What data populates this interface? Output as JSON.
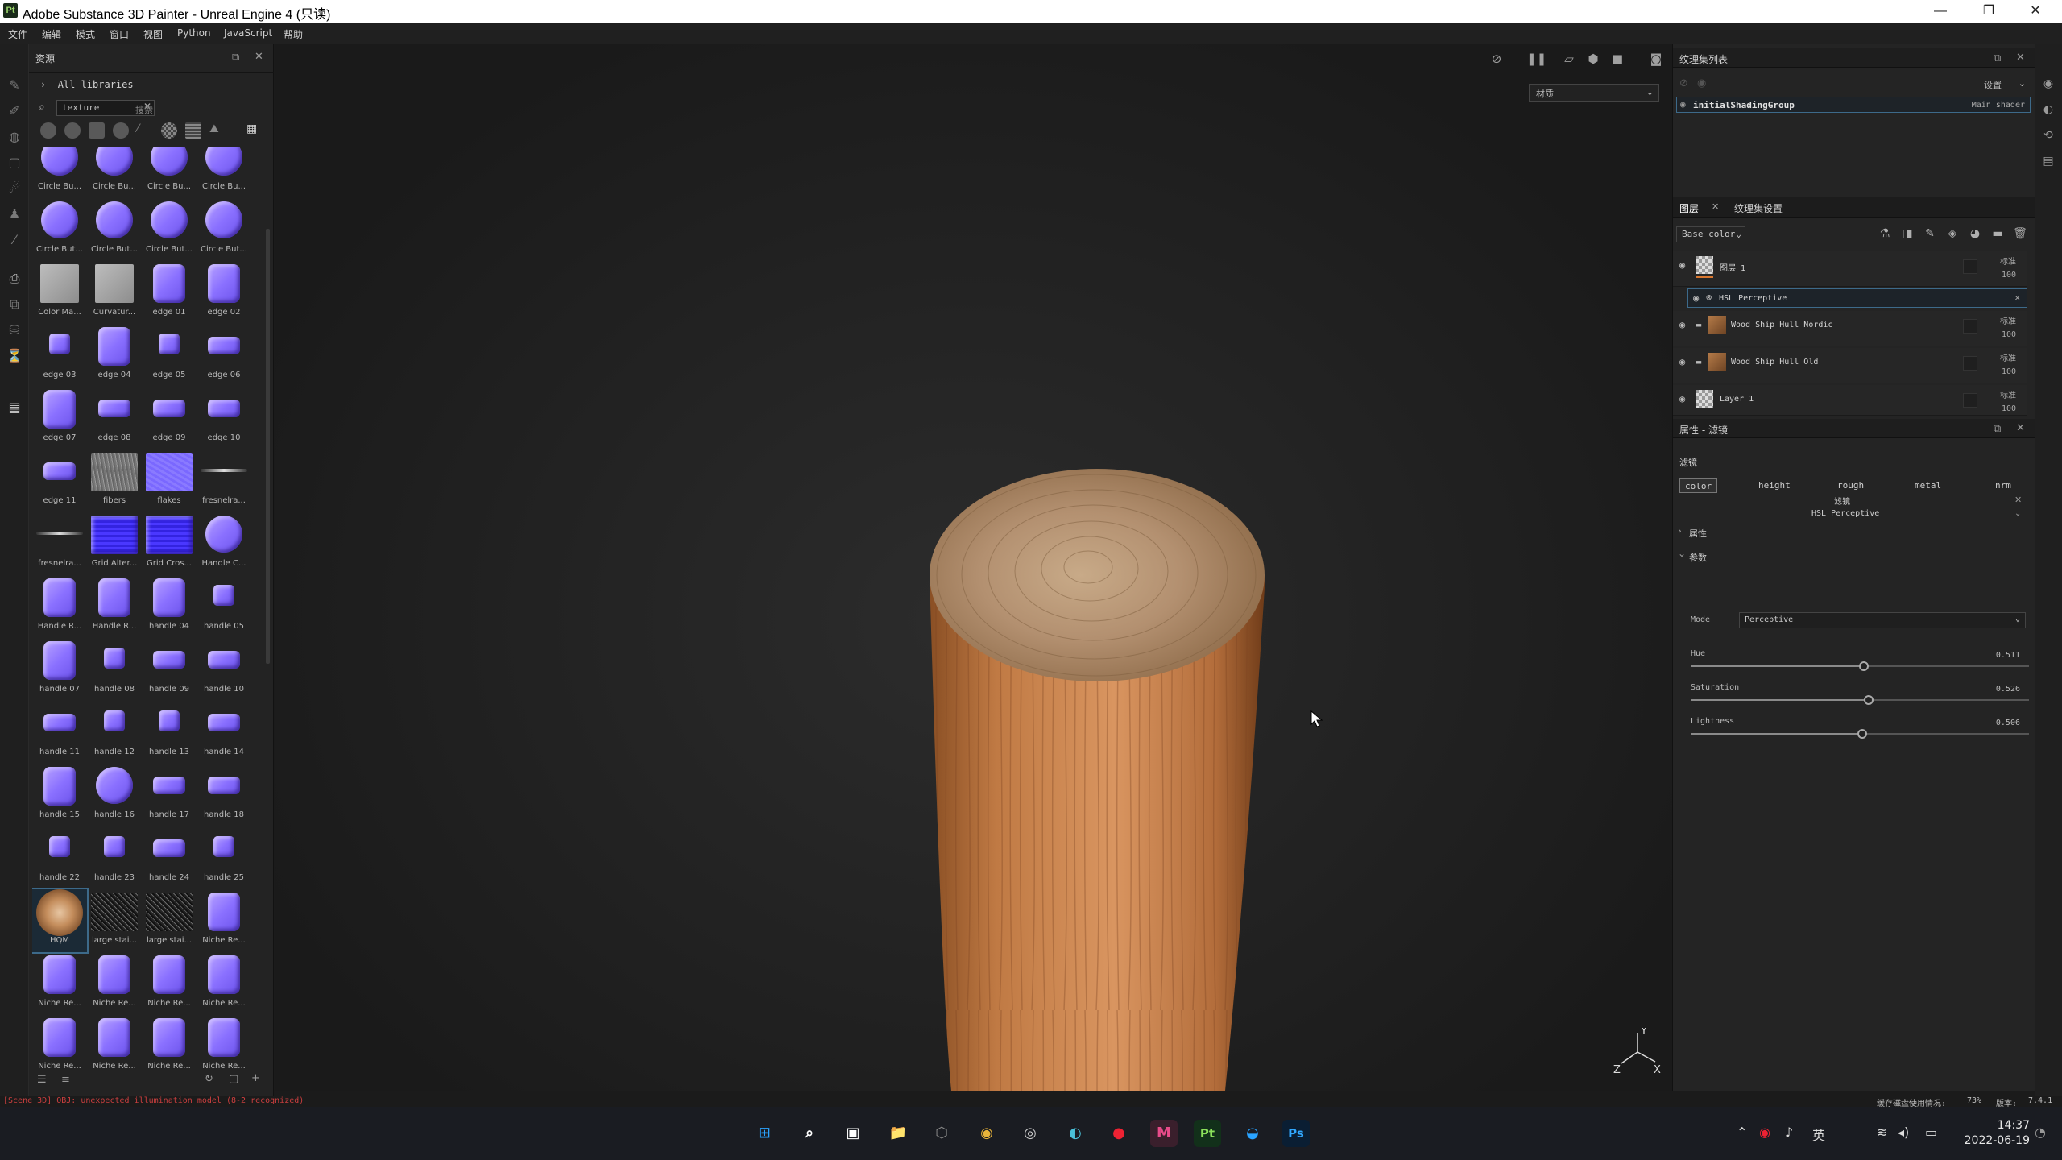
{
  "window": {
    "title": "Adobe Substance 3D Painter - Unreal Engine 4 (只读)",
    "app_icon": "Pt",
    "controls": [
      "—",
      "❐",
      "✕"
    ]
  },
  "menu": [
    "文件",
    "编辑",
    "模式",
    "窗口",
    "视图",
    "Python",
    "JavaScript",
    "帮助"
  ],
  "assets_panel": {
    "title": "资源",
    "breadcrumb": "All libraries",
    "search_value": "texture",
    "search_label": "搜索",
    "items": [
      {
        "label": "Circle Bu...",
        "shape": "round"
      },
      {
        "label": "Circle Bu...",
        "shape": "round"
      },
      {
        "label": "Circle Bu...",
        "shape": "round"
      },
      {
        "label": "Circle Bu...",
        "shape": "round"
      },
      {
        "label": "Circle But...",
        "shape": "round"
      },
      {
        "label": "Circle But...",
        "shape": "round"
      },
      {
        "label": "Circle But...",
        "shape": "round"
      },
      {
        "label": "Circle But...",
        "shape": "round"
      },
      {
        "label": "Color Ma...",
        "shape": "gray"
      },
      {
        "label": "Curvatur...",
        "shape": "gray"
      },
      {
        "label": "edge 01",
        "shape": "tall"
      },
      {
        "label": "edge 02",
        "shape": "tall"
      },
      {
        "label": "edge 03",
        "shape": "small"
      },
      {
        "label": "edge 04",
        "shape": "tall"
      },
      {
        "label": "edge 05",
        "shape": "small"
      },
      {
        "label": "edge 06",
        "shape": "wide"
      },
      {
        "label": "edge 07",
        "shape": "tall"
      },
      {
        "label": "edge 08",
        "shape": "wide"
      },
      {
        "label": "edge 09",
        "shape": "wide"
      },
      {
        "label": "edge 10",
        "shape": "wide"
      },
      {
        "label": "edge 11",
        "shape": "wide"
      },
      {
        "label": "fibers",
        "shape": "fibers"
      },
      {
        "label": "flakes",
        "shape": "flakes"
      },
      {
        "label": "fresnelra...",
        "shape": "line"
      },
      {
        "label": "fresnelra...",
        "shape": "line"
      },
      {
        "label": "Grid Alter...",
        "shape": "gridpat"
      },
      {
        "label": "Grid Cros...",
        "shape": "gridpat"
      },
      {
        "label": "Handle C...",
        "shape": "round"
      },
      {
        "label": "Handle R...",
        "shape": "tall"
      },
      {
        "label": "Handle R...",
        "shape": "tall"
      },
      {
        "label": "handle 04",
        "shape": "tall"
      },
      {
        "label": "handle 05",
        "shape": "small"
      },
      {
        "label": "handle 07",
        "shape": "tall"
      },
      {
        "label": "handle 08",
        "shape": "small"
      },
      {
        "label": "handle 09",
        "shape": "wide"
      },
      {
        "label": "handle 10",
        "shape": "wide"
      },
      {
        "label": "handle 11",
        "shape": "wide"
      },
      {
        "label": "handle 12",
        "shape": "small"
      },
      {
        "label": "handle 13",
        "shape": "small"
      },
      {
        "label": "handle 14",
        "shape": "wide"
      },
      {
        "label": "handle 15",
        "shape": "tall"
      },
      {
        "label": "handle 16",
        "shape": "round"
      },
      {
        "label": "handle 17",
        "shape": "wide"
      },
      {
        "label": "handle 18",
        "shape": "wide"
      },
      {
        "label": "handle 22",
        "shape": "small"
      },
      {
        "label": "handle 23",
        "shape": "small"
      },
      {
        "label": "handle 24",
        "shape": "wide"
      },
      {
        "label": "handle 25",
        "shape": "small"
      },
      {
        "label": "HQM",
        "shape": "wood",
        "selected": true
      },
      {
        "label": "large stai...",
        "shape": "noise"
      },
      {
        "label": "large stai...",
        "shape": "noise"
      },
      {
        "label": "Niche Re...",
        "shape": "tall"
      },
      {
        "label": "Niche Re...",
        "shape": "tall"
      },
      {
        "label": "Niche Re...",
        "shape": "tall"
      },
      {
        "label": "Niche Re...",
        "shape": "tall"
      },
      {
        "label": "Niche Re...",
        "shape": "tall"
      },
      {
        "label": "Niche Re...",
        "shape": "tall"
      },
      {
        "label": "Niche Re...",
        "shape": "tall"
      },
      {
        "label": "Niche Re...",
        "shape": "tall"
      },
      {
        "label": "Niche Re...",
        "shape": "tall"
      }
    ]
  },
  "viewport": {
    "material_mode": "材质",
    "axis_labels": {
      "y": "Y",
      "z": "Z",
      "x": "X"
    }
  },
  "texture_set_list": {
    "title": "纹理集列表",
    "settings_label": "设置",
    "set_name": "initialShadingGroup",
    "shader": "Main shader"
  },
  "layers_panel": {
    "tab_layers": "图层",
    "tab_settings": "纹理集设置",
    "channel_dropdown": "Base color",
    "layers": [
      {
        "name": "图层 1",
        "blend": "标准",
        "opacity": "100",
        "type": "fill"
      },
      {
        "name": "HSL Perceptive",
        "type": "filter"
      },
      {
        "name": "Wood Ship Hull Nordic",
        "blend": "标准",
        "opacity": "100",
        "type": "folder"
      },
      {
        "name": "Wood Ship Hull Old",
        "blend": "标准",
        "opacity": "100",
        "type": "folder"
      },
      {
        "name": "Layer 1",
        "blend": "标准",
        "opacity": "100",
        "type": "fill"
      }
    ]
  },
  "properties_panel": {
    "title": "属性 - 滤镜",
    "section_filter": "滤镜",
    "channels": [
      "color",
      "height",
      "rough",
      "metal",
      "nrm"
    ],
    "active_channel": "color",
    "filter_heading": "滤镜",
    "filter_name": "HSL Perceptive",
    "section_attributes": "属性",
    "section_parameters": "参数",
    "mode_label": "Mode",
    "mode_value": "Perceptive",
    "params": [
      {
        "label": "Hue",
        "value": "0.511",
        "fraction": 0.511
      },
      {
        "label": "Saturation",
        "value": "0.526",
        "fraction": 0.526
      },
      {
        "label": "Lightness",
        "value": "0.506",
        "fraction": 0.506
      }
    ]
  },
  "status": {
    "log": "[Scene 3D] OBJ: unexpected illumination model (8-2 recognized)",
    "right": "缓存磁盘使用情况:",
    "disk": "73%",
    "version_label": "版本:",
    "version": "7.4.1"
  },
  "taskbar": {
    "apps": [
      "⊞",
      "⌕",
      "▣",
      "📁",
      "⬡",
      "◉",
      "◎",
      "◐",
      "●",
      "M",
      "Pt",
      "◒",
      "Ps"
    ],
    "tray_lang": "英",
    "time": "14:37",
    "date": "2022-06-19"
  },
  "colors": {
    "accent": "#3d6a8a",
    "error_log": "#cc3f3f",
    "normal_thumb": "#8a70ff"
  }
}
